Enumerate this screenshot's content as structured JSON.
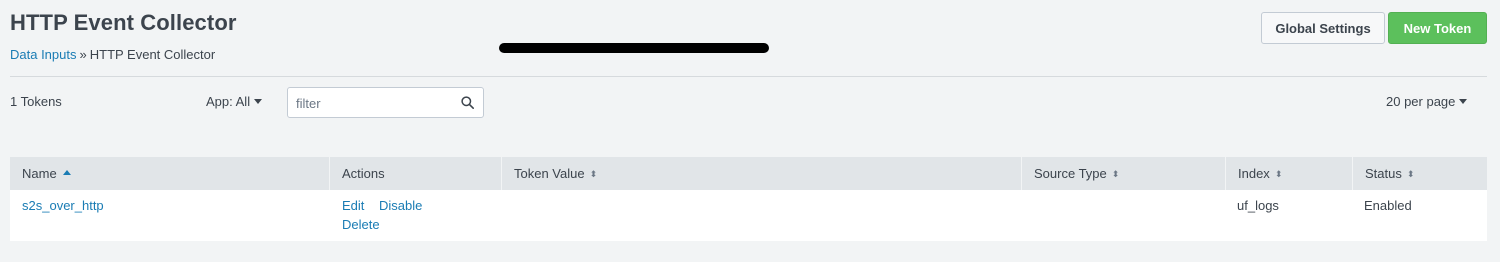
{
  "header": {
    "title": "HTTP Event Collector",
    "breadcrumb": {
      "link": "Data Inputs",
      "separator": "»",
      "current": "HTTP Event Collector"
    },
    "global_settings_label": "Global Settings",
    "new_token_label": "New Token"
  },
  "toolbar": {
    "token_count": "1 Tokens",
    "app_filter": "App: All",
    "filter_placeholder": "filter",
    "filter_value": "",
    "per_page": "20 per page"
  },
  "table": {
    "columns": [
      "Name",
      "Actions",
      "Token Value",
      "Source Type",
      "Index",
      "Status"
    ],
    "rows": [
      {
        "name": "s2s_over_http",
        "actions": [
          "Edit",
          "Disable",
          "Delete"
        ],
        "source_type": "",
        "index": "uf_logs",
        "status": "Enabled"
      }
    ]
  },
  "colors": {
    "link": "#1a7cb4",
    "primary_button": "#5cc05c",
    "background": "#f2f4f5",
    "header_row": "#e1e5e8"
  },
  "icons": [
    "search-icon",
    "caret-down-icon",
    "sort-icon",
    "sort-asc-icon"
  ]
}
